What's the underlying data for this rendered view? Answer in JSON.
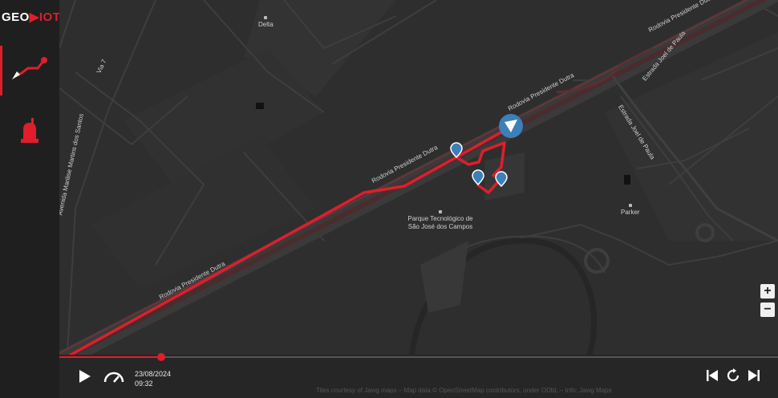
{
  "app": {
    "logo_text": "GEO",
    "logo_text_accent": "IOT"
  },
  "sidebar": {
    "items": [
      {
        "name": "route-playback",
        "icon": "route-icon",
        "active": true
      },
      {
        "name": "alerts",
        "icon": "siren-icon",
        "active": false
      }
    ]
  },
  "map": {
    "labels": {
      "delta": "Delta",
      "via7": "Via 7",
      "avenida": "Avenida Marilise Martins dos Santos",
      "dutra_top": "Rodovia Presidente Dutra",
      "dutra_mid": "Rodovia Presidente Dutra",
      "dutra_left": "Rodovia Presidente Dutra",
      "dutra_low": "Rodovia Presidente Dutra",
      "estrada1": "Estrada Joel de Paula",
      "estrada2": "Estrada Joel de Paula",
      "parque": "Parque Tecnológico de São José dos Campos",
      "parker": "Parker"
    },
    "zoom_in": "+",
    "zoom_out": "−",
    "route_color": "#e01e2b",
    "marker_color": "#3d7fb8"
  },
  "player": {
    "date": "23/08/2024",
    "time": "09:32",
    "progress": 0.142,
    "attribution": "Tiles courtesy of Jawg maps – Map data © OpenStreetMap contributors, under ODbL – Info: Jawg Maps"
  }
}
